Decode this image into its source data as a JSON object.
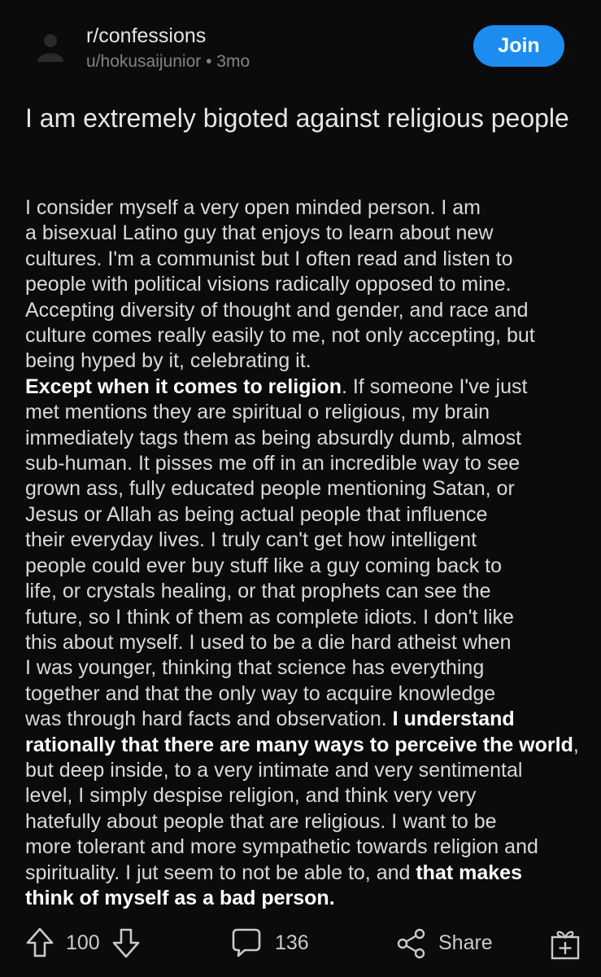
{
  "post": {
    "community": "r/confessions",
    "author": "u/hokusaijunior",
    "age": "3mo",
    "join_label": "Join",
    "title": "I am extremely bigoted against religious people",
    "body_parts": [
      "I consider myself a very open minded person. I am\na bisexual Latino guy that enjoys to learn about new\ncultures. I'm a communist but I often read and listen  to\npeople  with  political visions radically opposed to mine.\nAccepting diversity of thought and gender, and race and\nculture comes really easily to me, not only accepting, but\nbeing hyped by it, celebrating it.\n",
      "Except when it comes to religion",
      ". If someone  I've just\nmet mentions they are spiritual o religious, my brain\nimmediately tags them as being absurdly dumb, almost\nsub-human.  It pisses me off in an incredible way to see\ngrown ass, fully educated people mentioning Satan, or\nJesus or Allah as being actual people that influence\ntheir everyday lives.  I truly can't get how intelligent\npeople could ever  buy stuff like a guy coming back to\nlife, or crystals healing, or that prophets can see the\nfuture, so I think of them as complete idiots. I don't like\nthis  about myself. I used to be a die hard atheist when\nI was younger, thinking that science has  everything\ntogether and  that the only way to acquire  knowledge\nwas through hard facts and observation. ",
      "I understand\nrationally that  there are many ways to perceive the world",
      ",\nbut deep inside, to a very intimate and very sentimental\nlevel, I simply  despise  religion, and think very very\nhatefully about people that are religious.  I want to be\nmore tolerant and more sympathetic towards religion and\nspirituality. I jut seem to not be able to, and ",
      "that makes\nthink of myself as a bad person."
    ]
  },
  "actions": {
    "votes": "100",
    "comments": "136",
    "share_label": "Share"
  },
  "colors": {
    "background": "#0b0b0b",
    "join_button": "#1d8cf0",
    "text": "#d7dadc",
    "meta": "#818384"
  },
  "icons": [
    "avatar-icon",
    "upvote-icon",
    "downvote-icon",
    "comment-icon",
    "share-icon",
    "award-icon"
  ]
}
